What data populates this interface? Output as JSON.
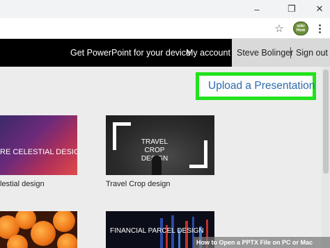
{
  "browser": {
    "extension_label": "wiki How"
  },
  "nav": {
    "get_powerpoint": "Get PowerPoint for your device",
    "my_account": "My account",
    "user_name": "Steve Bolinger",
    "sign_out": "Sign out"
  },
  "upload": {
    "label": "Upload a Presentation"
  },
  "templates": [
    {
      "thumb_title": "RE CELESTIAL DESIGN",
      "label": "lestial design"
    },
    {
      "thumb_title": "TRAVEL CROP DESIGN",
      "label": "Travel Crop design"
    },
    {
      "thumb_title": "",
      "label": ""
    },
    {
      "thumb_title": "FINANCIAL PARCEL DESIGN",
      "label": ""
    }
  ],
  "overlay": {
    "text": "How to Open a PPTX File on PC or Mac"
  },
  "colors": {
    "nav_bg": "#000000",
    "highlight": "#22e21c",
    "link_blue": "#2b6cb0"
  }
}
